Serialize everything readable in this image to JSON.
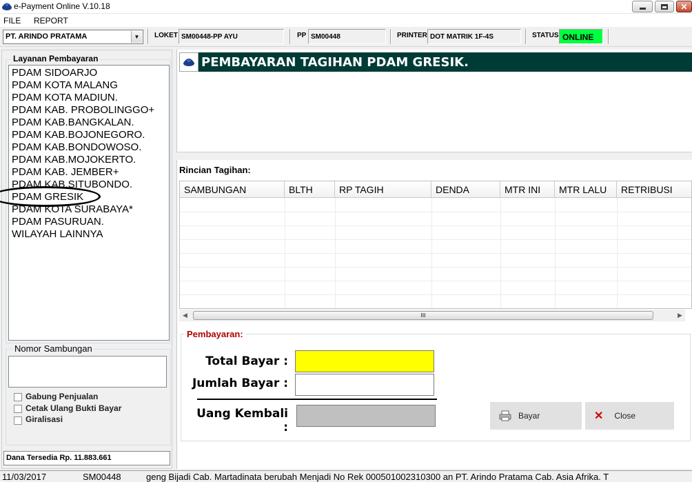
{
  "window": {
    "title": "e-Payment Online V.10.18"
  },
  "menu": [
    "FILE",
    "REPORT"
  ],
  "toolbar": {
    "company": "PT. ARINDO PRATAMA",
    "loket_label": "LOKET",
    "loket_value": "SM00448-PP AYU",
    "pp_label": "PP",
    "pp_value": "SM00448",
    "printer_label": "PRINTER",
    "printer_value": "DOT MATRIK 1F-4S",
    "status_label": "STATUS",
    "status_value": "ONLINE",
    "status_color": "#00ff40"
  },
  "sidebar": {
    "group_label": "Layanan Pembayaran",
    "items": [
      "PDAM SIDOARJO",
      "PDAM KOTA MALANG",
      "PDAM KOTA MADIUN.",
      "PDAM KAB. PROBOLINGGO+",
      "PDAM KAB.BANGKALAN.",
      "PDAM KAB.BOJONEGORO.",
      "PDAM KAB.BONDOWOSO.",
      "PDAM KAB.MOJOKERTO.",
      "PDAM KAB. JEMBER+",
      "PDAM KAB.SITUBONDO.",
      "PDAM GRESIK",
      "PDAM KOTA SURABAYA*",
      "PDAM PASURUAN.",
      "WILAYAH LAINNYA"
    ],
    "nomor_label": "Nomor Sambungan",
    "nomor_value": "",
    "checkboxes": [
      "Gabung Penjualan",
      "Cetak Ulang Bukti Bayar",
      "Giralisasi"
    ],
    "dana": "Dana Tersedia Rp.  11.883.661"
  },
  "main": {
    "banner": "PEMBAYARAN TAGIHAN PDAM GRESIK.",
    "banner_color": "#003b36",
    "rincian_label": "Rincian Tagihan:",
    "columns": [
      "SAMBUNGAN",
      "BLTH",
      "RP TAGIH",
      "DENDA",
      "MTR INI",
      "MTR LALU",
      "RETRIBUSI"
    ],
    "scroll_grip": "III",
    "pembayaran_label": "Pembayaran:",
    "total_label": "Total Bayar :",
    "jumlah_label": "Jumlah Bayar :",
    "kembali_label": "Uang Kembali :",
    "total_value": "",
    "jumlah_value": "",
    "kembali_value": "",
    "total_field_color": "#ffff00",
    "bayar_label": "Bayar",
    "close_label": "Close"
  },
  "statusbar": {
    "date": "11/03/2017",
    "id": "SM00448",
    "ticker": "geng Bijadi Cab. Martadinata berubah Menjadi No Rek 000501002310300 an PT. Arindo Pratama Cab. Asia Afrika. T"
  }
}
